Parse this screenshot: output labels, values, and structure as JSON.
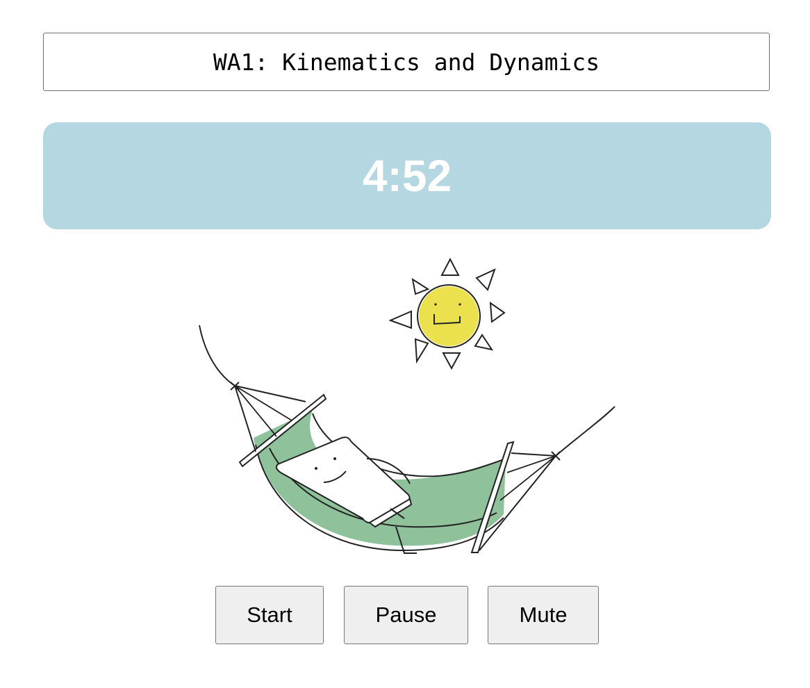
{
  "title": "WA1: Kinematics and Dynamics",
  "timer": {
    "display": "4:52",
    "background_color": "#b5d7e2",
    "text_color": "#ffffff"
  },
  "illustration": {
    "icon": "hammock-relaxing-illustration",
    "sun_color": "#ebe14e",
    "hammock_color": "#8fc19b"
  },
  "controls": {
    "start_label": "Start",
    "pause_label": "Pause",
    "mute_label": "Mute"
  }
}
